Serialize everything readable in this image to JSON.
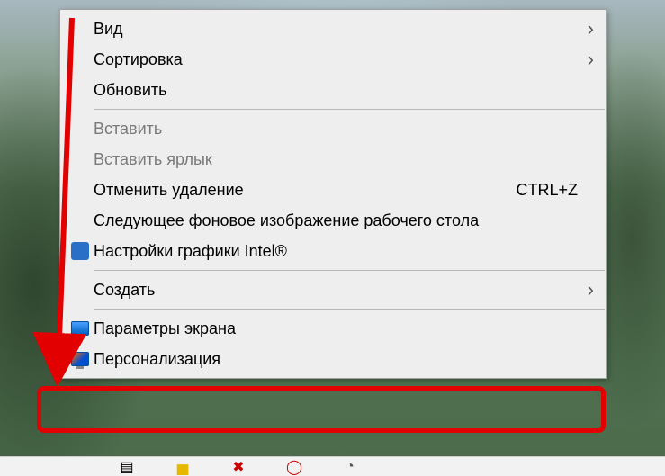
{
  "context_menu": {
    "items": [
      {
        "label": "Вид",
        "has_submenu": true,
        "enabled": true,
        "icon": null,
        "shortcut": null
      },
      {
        "label": "Сортировка",
        "has_submenu": true,
        "enabled": true,
        "icon": null,
        "shortcut": null
      },
      {
        "label": "Обновить",
        "has_submenu": false,
        "enabled": true,
        "icon": null,
        "shortcut": null
      },
      {
        "separator": true
      },
      {
        "label": "Вставить",
        "has_submenu": false,
        "enabled": false,
        "icon": null,
        "shortcut": null
      },
      {
        "label": "Вставить ярлык",
        "has_submenu": false,
        "enabled": false,
        "icon": null,
        "shortcut": null
      },
      {
        "label": "Отменить удаление",
        "has_submenu": false,
        "enabled": true,
        "icon": null,
        "shortcut": "CTRL+Z"
      },
      {
        "label": "Следующее фоновое изображение рабочего стола",
        "has_submenu": false,
        "enabled": true,
        "icon": null,
        "shortcut": null
      },
      {
        "label": "Настройки графики Intel®",
        "has_submenu": false,
        "enabled": true,
        "icon": "intel-icon",
        "shortcut": null
      },
      {
        "separator": true
      },
      {
        "label": "Создать",
        "has_submenu": true,
        "enabled": true,
        "icon": null,
        "shortcut": null
      },
      {
        "separator": true
      },
      {
        "label": "Параметры экрана",
        "has_submenu": false,
        "enabled": true,
        "icon": "monitor-icon",
        "shortcut": null
      },
      {
        "label": "Персонализация",
        "has_submenu": false,
        "enabled": true,
        "icon": "personalize-icon",
        "shortcut": null
      }
    ]
  },
  "annotation": {
    "arrow_color": "#e20000",
    "highlight_target": "Персонализация"
  }
}
